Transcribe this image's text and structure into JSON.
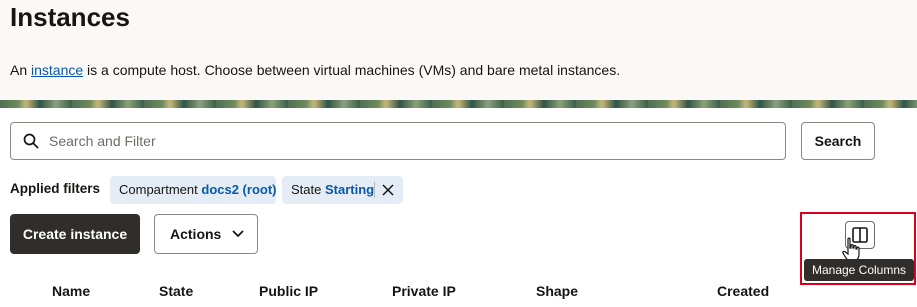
{
  "header": {
    "title": "Instances",
    "description_prefix": "An ",
    "description_link": "instance",
    "description_suffix": " is a compute host. Choose between virtual machines (VMs) and bare metal instances."
  },
  "search": {
    "placeholder": "Search and Filter",
    "button_label": "Search"
  },
  "filters": {
    "label": "Applied filters",
    "chips": [
      {
        "key": "Compartment",
        "value": "docs2 (root)"
      },
      {
        "key": "State",
        "value": "Starting"
      }
    ]
  },
  "toolbar": {
    "create_label": "Create instance",
    "actions_label": "Actions",
    "manage_columns_tooltip": "Manage Columns"
  },
  "table": {
    "columns": [
      "Name",
      "State",
      "Public IP",
      "Private IP",
      "Shape",
      "Created"
    ]
  },
  "colors": {
    "primary_button": "#312d2a",
    "link": "#0a58a8",
    "chip_bg": "#e4edf5",
    "highlight": "#d9001b"
  }
}
